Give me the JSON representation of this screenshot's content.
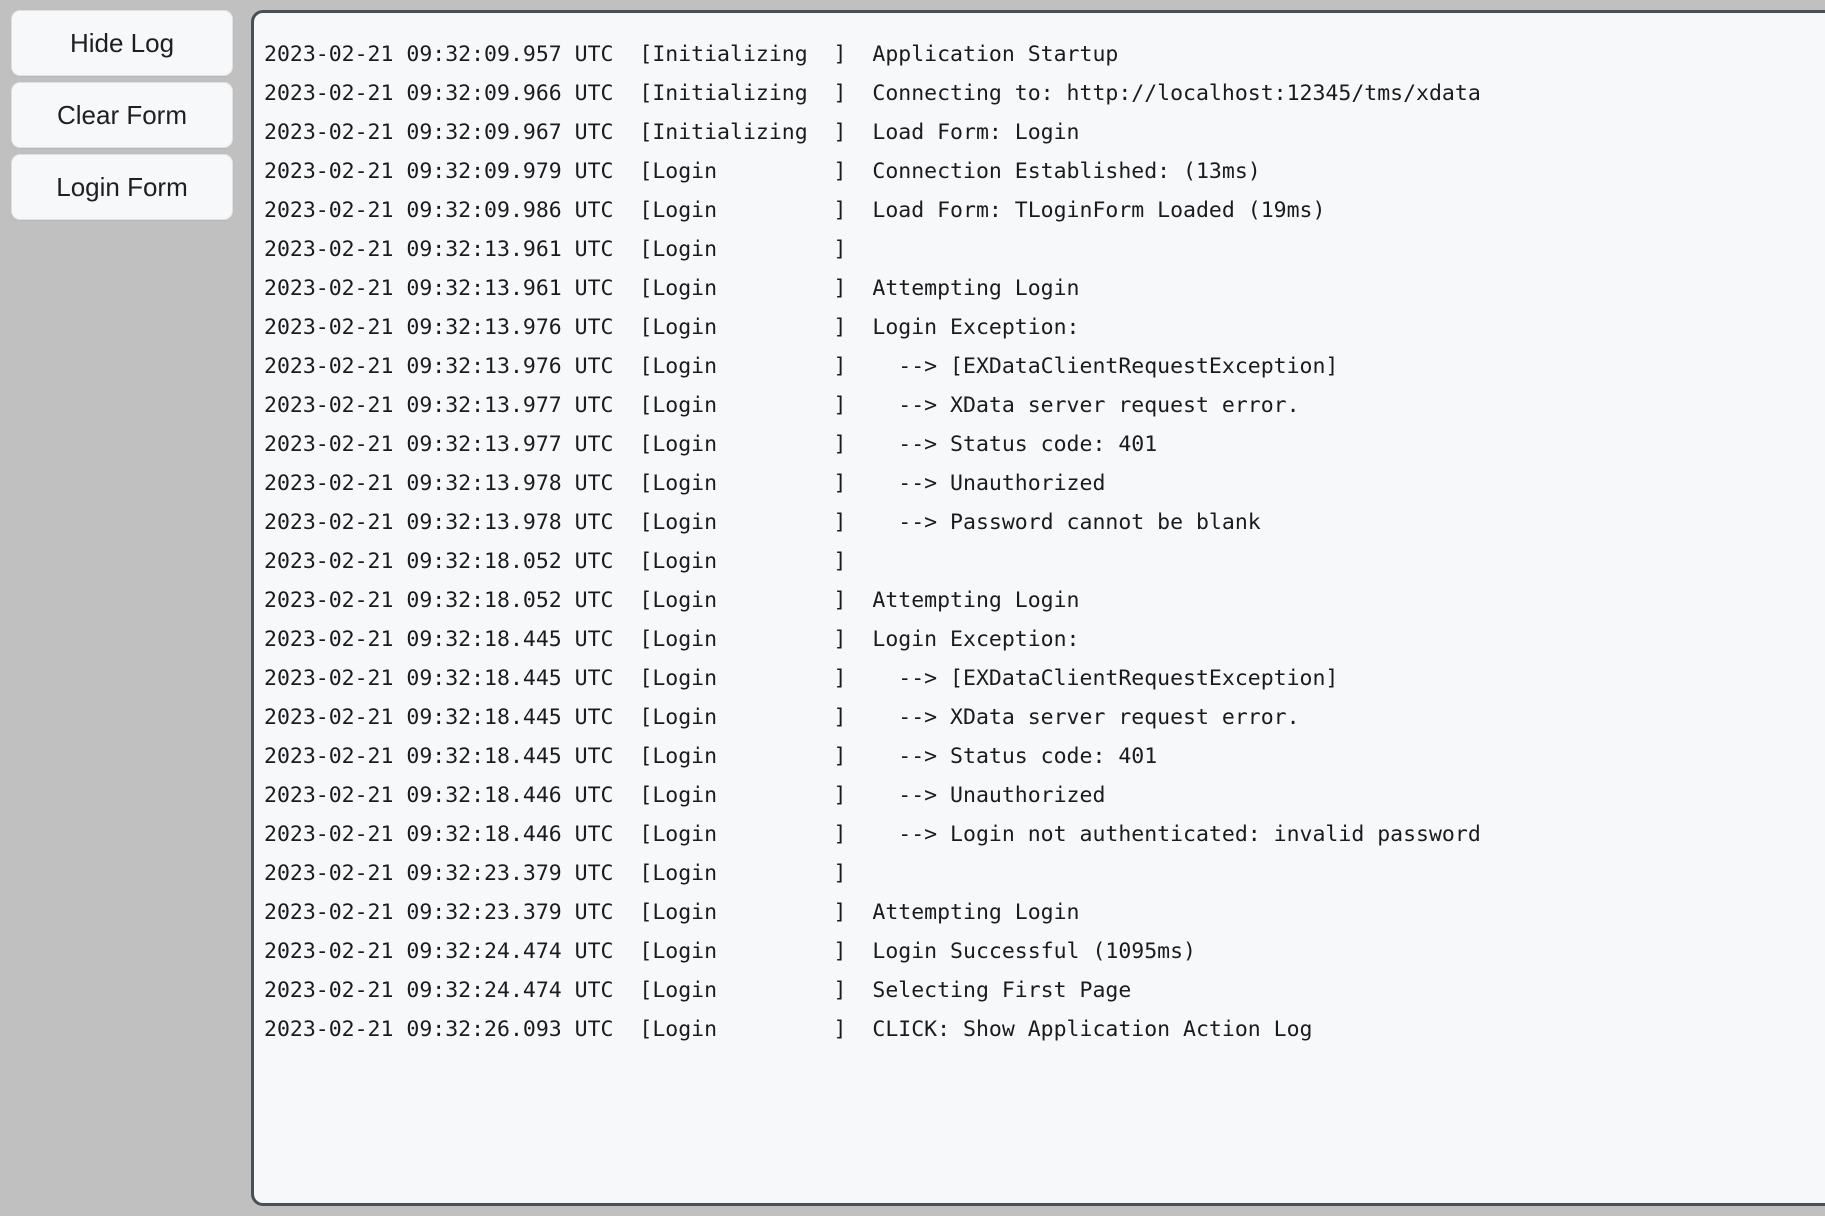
{
  "window": {
    "background_color": "#c0c0c0",
    "panel_background_color": "#f7f8fa",
    "panel_border_color": "#4a4f55",
    "text_color": "#1b1b1b"
  },
  "buttons": [
    {
      "label": "Hide Log",
      "name": "hide-log-button"
    },
    {
      "label": "Clear Form",
      "name": "clear-form-button"
    },
    {
      "label": "Login Form",
      "name": "login-form-button"
    }
  ],
  "log": {
    "category_width": 14,
    "lines": [
      {
        "timestamp": "2023-02-21 09:32:09.957 UTC",
        "category": "Initializing",
        "message": "Application Startup"
      },
      {
        "timestamp": "2023-02-21 09:32:09.966 UTC",
        "category": "Initializing",
        "message": "Connecting to: http://localhost:12345/tms/xdata"
      },
      {
        "timestamp": "2023-02-21 09:32:09.967 UTC",
        "category": "Initializing",
        "message": "Load Form: Login"
      },
      {
        "timestamp": "2023-02-21 09:32:09.979 UTC",
        "category": "Login",
        "message": "Connection Established: (13ms)"
      },
      {
        "timestamp": "2023-02-21 09:32:09.986 UTC",
        "category": "Login",
        "message": "Load Form: TLoginForm Loaded (19ms)"
      },
      {
        "timestamp": "2023-02-21 09:32:13.961 UTC",
        "category": "Login",
        "message": ""
      },
      {
        "timestamp": "2023-02-21 09:32:13.961 UTC",
        "category": "Login",
        "message": "Attempting Login"
      },
      {
        "timestamp": "2023-02-21 09:32:13.976 UTC",
        "category": "Login",
        "message": "Login Exception:"
      },
      {
        "timestamp": "2023-02-21 09:32:13.976 UTC",
        "category": "Login",
        "message": "  --> [EXDataClientRequestException]"
      },
      {
        "timestamp": "2023-02-21 09:32:13.977 UTC",
        "category": "Login",
        "message": "  --> XData server request error."
      },
      {
        "timestamp": "2023-02-21 09:32:13.977 UTC",
        "category": "Login",
        "message": "  --> Status code: 401"
      },
      {
        "timestamp": "2023-02-21 09:32:13.978 UTC",
        "category": "Login",
        "message": "  --> Unauthorized"
      },
      {
        "timestamp": "2023-02-21 09:32:13.978 UTC",
        "category": "Login",
        "message": "  --> Password cannot be blank"
      },
      {
        "timestamp": "2023-02-21 09:32:18.052 UTC",
        "category": "Login",
        "message": ""
      },
      {
        "timestamp": "2023-02-21 09:32:18.052 UTC",
        "category": "Login",
        "message": "Attempting Login"
      },
      {
        "timestamp": "2023-02-21 09:32:18.445 UTC",
        "category": "Login",
        "message": "Login Exception:"
      },
      {
        "timestamp": "2023-02-21 09:32:18.445 UTC",
        "category": "Login",
        "message": "  --> [EXDataClientRequestException]"
      },
      {
        "timestamp": "2023-02-21 09:32:18.445 UTC",
        "category": "Login",
        "message": "  --> XData server request error."
      },
      {
        "timestamp": "2023-02-21 09:32:18.445 UTC",
        "category": "Login",
        "message": "  --> Status code: 401"
      },
      {
        "timestamp": "2023-02-21 09:32:18.446 UTC",
        "category": "Login",
        "message": "  --> Unauthorized"
      },
      {
        "timestamp": "2023-02-21 09:32:18.446 UTC",
        "category": "Login",
        "message": "  --> Login not authenticated: invalid password"
      },
      {
        "timestamp": "2023-02-21 09:32:23.379 UTC",
        "category": "Login",
        "message": ""
      },
      {
        "timestamp": "2023-02-21 09:32:23.379 UTC",
        "category": "Login",
        "message": "Attempting Login"
      },
      {
        "timestamp": "2023-02-21 09:32:24.474 UTC",
        "category": "Login",
        "message": "Login Successful (1095ms)"
      },
      {
        "timestamp": "2023-02-21 09:32:24.474 UTC",
        "category": "Login",
        "message": "Selecting First Page"
      },
      {
        "timestamp": "2023-02-21 09:32:26.093 UTC",
        "category": "Login",
        "message": "CLICK: Show Application Action Log"
      }
    ]
  }
}
